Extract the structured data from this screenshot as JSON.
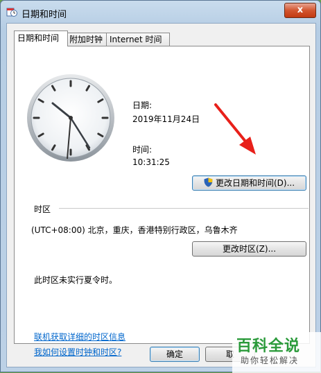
{
  "window": {
    "title": "日期和时间",
    "close_glyph": "x"
  },
  "tabs": [
    {
      "label": "日期和时间",
      "active": true
    },
    {
      "label": "附加时钟",
      "active": false
    },
    {
      "label": "Internet 时间",
      "active": false
    }
  ],
  "datetime": {
    "date_label": "日期:",
    "date_value": "2019年11月24日",
    "time_label": "时间:",
    "time_value": "10:31:25",
    "change_button": "更改日期和时间(D)..."
  },
  "timezone": {
    "group_label": "时区",
    "current": "(UTC+08:00) 北京，重庆，香港特别行政区，乌鲁木齐",
    "change_button": "更改时区(Z)...",
    "dst_note": "此时区未实行夏令时。"
  },
  "links": [
    "联机获取详细的时区信息",
    "我如何设置时钟和时区?"
  ],
  "footer": {
    "ok_button": "确定",
    "cancel_button": "取"
  },
  "watermark": {
    "title": "百科全说",
    "subtitle": "助你轻松解决"
  },
  "colors": {
    "accent_arrow": "#e8201a",
    "link": "#0066cc"
  }
}
